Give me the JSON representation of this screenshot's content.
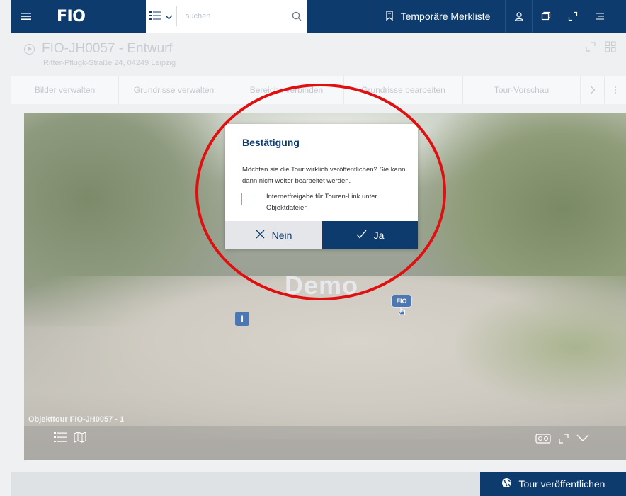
{
  "header": {
    "logo": "FIO",
    "search_placeholder": "suchen",
    "merkliste_label": "Temporäre Merkliste"
  },
  "object": {
    "title": "FIO-JH0057 - Entwurf",
    "address": "Ritter-Pflugk-Straße 24, 04249 Leipzig"
  },
  "tabs": [
    {
      "label": "Bilder verwalten"
    },
    {
      "label": "Grundrisse verwalten"
    },
    {
      "label": "Bereiche verbinden"
    },
    {
      "label": "Grundrisse bearbeiten"
    },
    {
      "label": "Tour-Vorschau"
    }
  ],
  "viewer": {
    "watermark": "Demo",
    "hotspot_info": "i",
    "hotspot_logo": "FIO",
    "tour_label": "Objekttour FIO-JH0057 - 1"
  },
  "dialog": {
    "title": "Bestätigung",
    "message": "Möchten sie die Tour wirklich veröffentlichen? Sie kann dann nicht weiter bearbeitet werden.",
    "checkbox_label": "Internetfreigabe für Touren-Link unter Objektdateien",
    "checkbox_checked": false,
    "cancel_label": "Nein",
    "confirm_label": "Ja"
  },
  "footer": {
    "publish_label": "Tour veröffentlichen"
  },
  "colors": {
    "brand": "#0e3b6d",
    "annotation": "#e01010"
  },
  "icons": [
    "hamburger-icon",
    "list-view-icon",
    "chevron-down-icon",
    "search-icon",
    "bookmark-icon",
    "user-icon",
    "copy-window-icon",
    "expand-icon",
    "collapse-menu-icon",
    "play-icon",
    "grid-icon",
    "chevron-right-icon",
    "more-vertical-icon",
    "close-icon",
    "check-icon",
    "map-icon",
    "vr-glasses-icon",
    "globe-icon",
    "hand-pointer-icon"
  ]
}
